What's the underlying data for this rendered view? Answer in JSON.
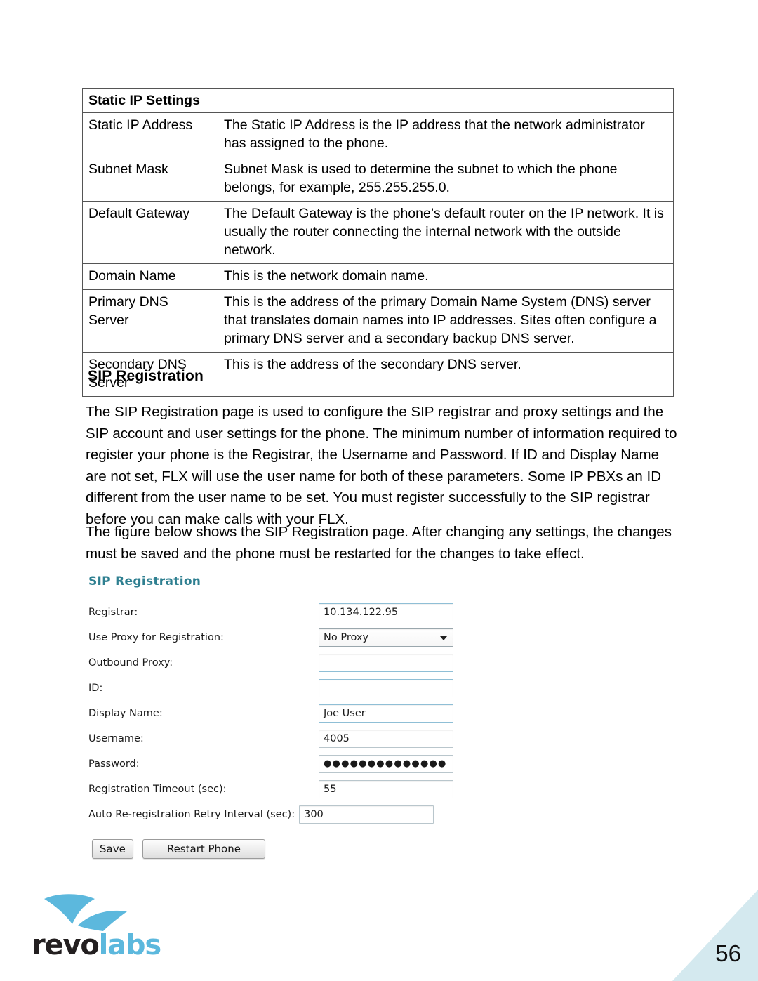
{
  "table": {
    "header": "Static IP Settings",
    "rows": [
      {
        "key": "Static IP Address",
        "value": "The Static IP Address is the IP address that the network administrator has assigned to the phone."
      },
      {
        "key": "Subnet Mask",
        "value": "Subnet Mask is used to determine the subnet to which the phone belongs, for example, 255.255.255.0."
      },
      {
        "key": "Default Gateway",
        "value": "The Default Gateway is the phone’s default router on the IP network. It is usually the router connecting the internal network with the outside network."
      },
      {
        "key": "Domain Name",
        "value": "This is the network domain name."
      },
      {
        "key": "Primary DNS Server",
        "value": "This is the address of the primary Domain Name System (DNS) server that translates domain names into IP addresses. Sites often configure a primary DNS server and a secondary backup DNS server."
      },
      {
        "key": "Secondary DNS Server",
        "value": "This is the address of the secondary DNS server."
      }
    ]
  },
  "section": {
    "heading": "SIP Registration",
    "paragraph_1": "The SIP Registration page is used to configure the SIP registrar and proxy settings and the SIP account and user settings for the phone. The minimum number of information required to register your phone is the Registrar, the Username and Password.  If ID and Display Name are not set, FLX will use the user name for both of these parameters.  Some IP PBXs an ID different from the user name to be set.  You must register successfully to the SIP registrar before you can make calls with your FLX.",
    "paragraph_2": "The figure below shows the SIP Registration page. After changing any settings, the changes must be saved and the phone must be restarted for the changes to take effect."
  },
  "app": {
    "title": "SIP Registration",
    "title_color": "#2e7f90",
    "fields": {
      "registrar": {
        "label": "Registrar:",
        "value": "10.134.122.95"
      },
      "use_proxy": {
        "label": "Use Proxy for Registration:",
        "value": "No Proxy"
      },
      "outbound_proxy": {
        "label": "Outbound Proxy:",
        "value": ""
      },
      "id": {
        "label": "ID:",
        "value": ""
      },
      "display_name": {
        "label": "Display Name:",
        "value": "Joe User"
      },
      "username": {
        "label": "Username:",
        "value": "4005"
      },
      "password": {
        "label": "Password:",
        "value": "●●●●●●●●●●●●●●"
      },
      "registration_timeout": {
        "label": "Registration Timeout (sec):",
        "value": "55"
      },
      "retry_interval": {
        "label": "Auto Re-registration Retry Interval (sec):",
        "value": "300"
      }
    },
    "buttons": {
      "save": "Save",
      "restart": "Restart Phone"
    }
  },
  "footer": {
    "logo_text_primary": "revo",
    "logo_text_secondary": "labs",
    "logo_color": "#5cb8dd",
    "page_number": "56",
    "corner_color": "#d4e9ef"
  }
}
